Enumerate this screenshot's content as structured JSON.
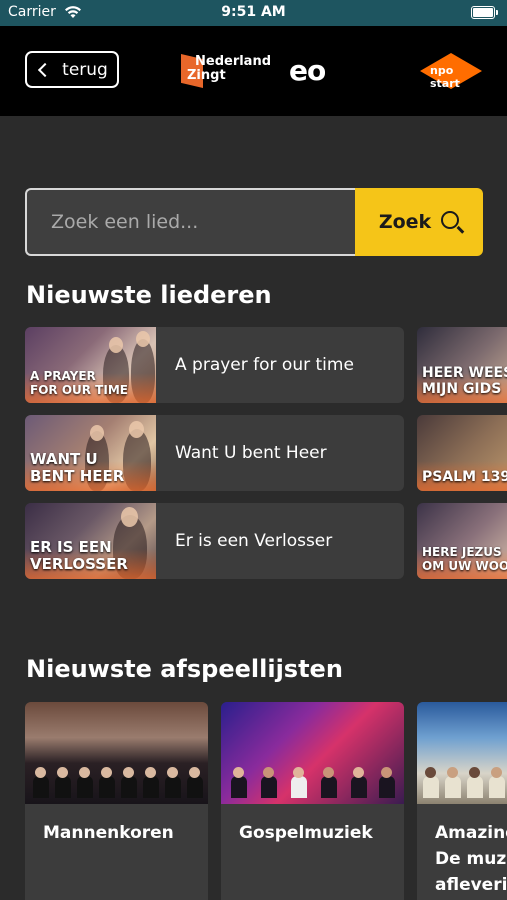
{
  "status_bar": {
    "carrier": "Carrier",
    "time": "9:51 AM"
  },
  "header": {
    "back_label": "terug",
    "brand_name": "Nederland\nZingt",
    "partner": "eo",
    "npo": "npo start"
  },
  "search": {
    "placeholder": "Zoek een lied...",
    "button_label": "Zoek"
  },
  "songs": {
    "title": "Nieuwste liederen",
    "items": [
      {
        "caption": "A PRAYER\nFOR OUR TIME",
        "title": "A prayer for our time"
      },
      {
        "caption": "WANT U\nBENT HEER",
        "title": "Want U bent Heer"
      },
      {
        "caption": "ER IS EEN\nVERLOSSER",
        "title": "Er is een Verlosser"
      }
    ],
    "side": [
      {
        "caption": "HEER WEES\nMIJN GIDS"
      },
      {
        "caption": "PSALM 139"
      },
      {
        "caption": "HERE JEZUS\nOM UW WOO"
      }
    ]
  },
  "playlists": {
    "title": "Nieuwste afspeellijsten",
    "items": [
      {
        "title": "Mannenkoren"
      },
      {
        "title": "Gospelmuziek"
      },
      {
        "title": "Amazing\nDe muzi\nafleverin"
      }
    ]
  },
  "colors": {
    "accent": "#f5c518",
    "brand_orange": "#e8672a",
    "header": "#000000",
    "status": "#1e5560"
  }
}
